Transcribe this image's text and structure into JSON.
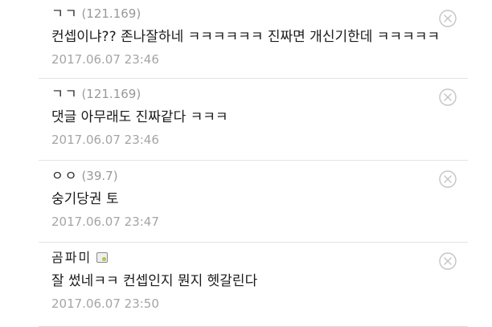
{
  "comments": [
    {
      "author": "ㄱㄱ",
      "ip": "(121.169)",
      "text": "컨셉이냐?? 존나잘하네 ㅋㅋㅋㅋㅋㅋ 진짜면 개신기한데 ㅋㅋㅋㅋㅋ",
      "date": "2017.06.07 23:46",
      "delete_icon": "close-circle-icon"
    },
    {
      "author": "ㄱㄱ",
      "ip": "(121.169)",
      "text": "댓글 아무래도 진짜같다 ㅋㅋㅋ",
      "date": "2017.06.07 23:46",
      "delete_icon": "close-circle-icon"
    },
    {
      "author": "ㅇㅇ",
      "ip": "(39.7)",
      "text": "숭기당권 토",
      "date": "2017.06.07 23:47",
      "delete_icon": "close-circle-icon"
    },
    {
      "author": "곰파미",
      "member_icon": "member-badge-icon",
      "text": "잘 썼네ㅋㅋ 컨셉인지 뭔지 헷갈린다",
      "date": "2017.06.07 23:50",
      "delete_icon": "close-circle-icon"
    }
  ],
  "colors": {
    "text": "#1a1a1a",
    "muted": "#a5a5a5",
    "divider": "#e3e3e3",
    "icon": "#c4c4c4"
  }
}
